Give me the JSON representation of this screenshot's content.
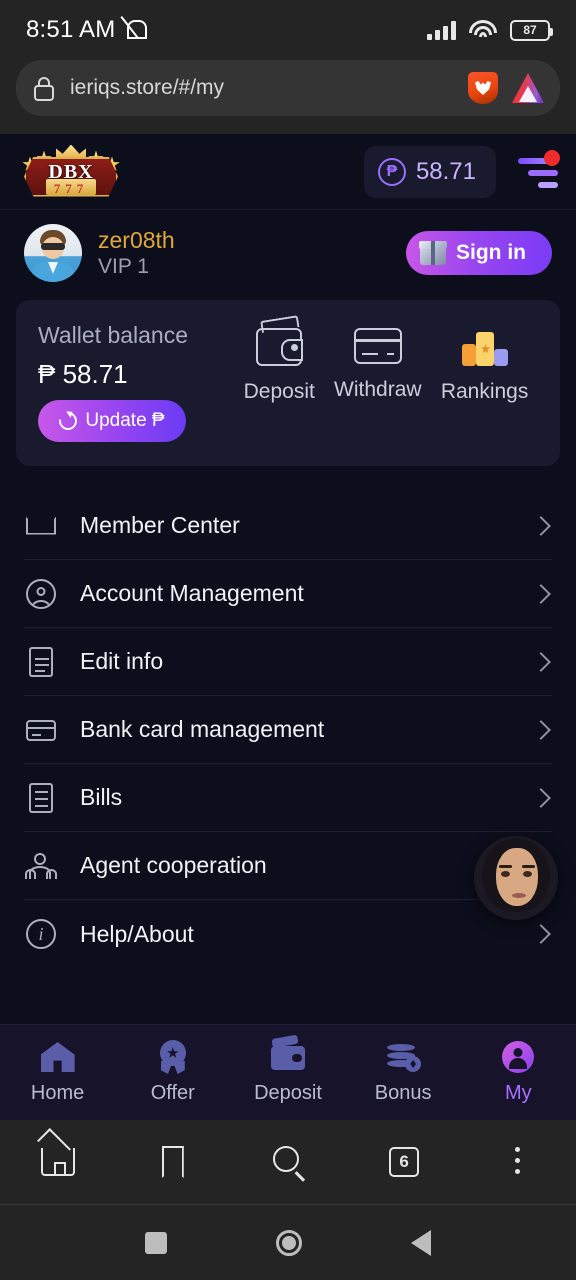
{
  "status_bar": {
    "time": "8:51 AM",
    "mute_icon": "bell-muted-icon",
    "signal_icon": "cellular-signal-icon",
    "wifi_icon": "wifi-icon",
    "battery_level": "87"
  },
  "browser": {
    "lock_icon": "lock-icon",
    "url": "ieriqs.store/#/my",
    "brave_shield_icon": "brave-lion-icon",
    "bat_rewards_icon": "bat-triangle-icon",
    "toolbar": {
      "home_icon": "home-icon",
      "bookmark_icon": "bookmark-icon",
      "search_icon": "search-icon",
      "tab_count": "6",
      "menu_icon": "overflow-menu-icon"
    }
  },
  "app_header": {
    "logo_title": "DBX",
    "logo_subtitle": "777",
    "balance_currency_icon": "peso-coin-icon",
    "balance_amount": "58.71",
    "menu_icon": "hamburger-menu-icon",
    "notification_badge": ""
  },
  "profile": {
    "avatar_icon": "user-avatar",
    "username": "zer08th",
    "vip_level": "VIP 1",
    "signin_label": "Sign in",
    "signin_icon": "gift-box-icon"
  },
  "wallet": {
    "label": "Wallet balance",
    "amount": "₱ 58.71",
    "update_label": "Update ₱",
    "update_icon": "refresh-icon",
    "actions": [
      {
        "label": "Deposit",
        "icon": "wallet-icon"
      },
      {
        "label": "Withdraw",
        "icon": "credit-card-icon"
      },
      {
        "label": "Rankings",
        "icon": "podium-ranking-icon"
      }
    ]
  },
  "menu": {
    "items": [
      {
        "label": "Member Center",
        "icon": "crown-icon"
      },
      {
        "label": "Account Management",
        "icon": "user-circle-icon"
      },
      {
        "label": "Edit info",
        "icon": "document-edit-icon"
      },
      {
        "label": "Bank card management",
        "icon": "bank-card-icon"
      },
      {
        "label": "Bills",
        "icon": "bills-list-icon"
      },
      {
        "label": "Agent cooperation",
        "icon": "two-people-icon"
      },
      {
        "label": "Help/About",
        "icon": "info-circle-icon"
      }
    ],
    "chevron_icon": "chevron-right-icon"
  },
  "support_widget": {
    "icon": "live-support-avatar"
  },
  "tab_bar": {
    "tabs": [
      {
        "label": "Home",
        "icon": "home-icon",
        "active": false
      },
      {
        "label": "Offer",
        "icon": "offer-badge-icon",
        "active": false
      },
      {
        "label": "Deposit",
        "icon": "wallet-icon",
        "active": false
      },
      {
        "label": "Bonus",
        "icon": "coins-icon",
        "active": false
      },
      {
        "label": "My",
        "icon": "user-icon",
        "active": true
      }
    ]
  },
  "android_nav": {
    "recents_icon": "square-recents-icon",
    "home_icon": "circle-home-icon",
    "back_icon": "triangle-back-icon"
  },
  "colors": {
    "page_bg": "#0d0e1c",
    "card_bg": "#191a2e",
    "accent_purple": "#9b6dff",
    "accent_gold": "#e0a83c",
    "badge_red": "#ef2b2b",
    "tabbar_bg": "#16132b"
  }
}
